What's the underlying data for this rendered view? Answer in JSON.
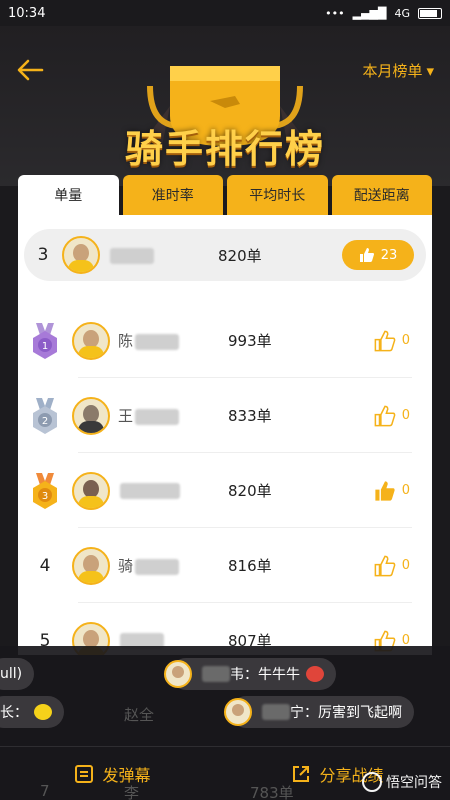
{
  "status_bar": {
    "time": "10:34",
    "network": "4G"
  },
  "header": {
    "title": "骑手排行榜",
    "period_label": "本月榜单"
  },
  "tabs": [
    {
      "label": "单量",
      "active": true
    },
    {
      "label": "准时率",
      "active": false
    },
    {
      "label": "平均时长",
      "active": false
    },
    {
      "label": "配送距离",
      "active": false
    }
  ],
  "my_row": {
    "rank": "3",
    "orders": "820单",
    "likes": "23"
  },
  "rows": [
    {
      "rank": "1",
      "medal": "gold",
      "name": "陈",
      "orders": "993单",
      "likes": "0",
      "liked": false
    },
    {
      "rank": "2",
      "medal": "silver",
      "name": "王",
      "orders": "833单",
      "likes": "0",
      "liked": false
    },
    {
      "rank": "3",
      "medal": "bronze",
      "name": "",
      "orders": "820单",
      "likes": "0",
      "liked": true
    },
    {
      "rank": "4",
      "medal": "",
      "name": "骑",
      "orders": "816单",
      "likes": "0",
      "liked": false
    },
    {
      "rank": "5",
      "medal": "",
      "name": "",
      "orders": "807单",
      "likes": "0",
      "liked": false
    }
  ],
  "danmaku": [
    {
      "text": "ull)"
    },
    {
      "text": "韦：牛牛牛"
    },
    {
      "text": "长："
    },
    {
      "text": "宁：厉害到飞起啊"
    }
  ],
  "row_partial": {
    "rank": "7",
    "name": "李",
    "orders": "783单"
  },
  "obscured_text": "赵全",
  "bottom_bar": {
    "danmaku_button": "发弹幕",
    "share_button": "分享战绩"
  },
  "watermark": "悟空问答",
  "colors": {
    "accent": "#f5b21a",
    "background": "#1b1a1d"
  }
}
